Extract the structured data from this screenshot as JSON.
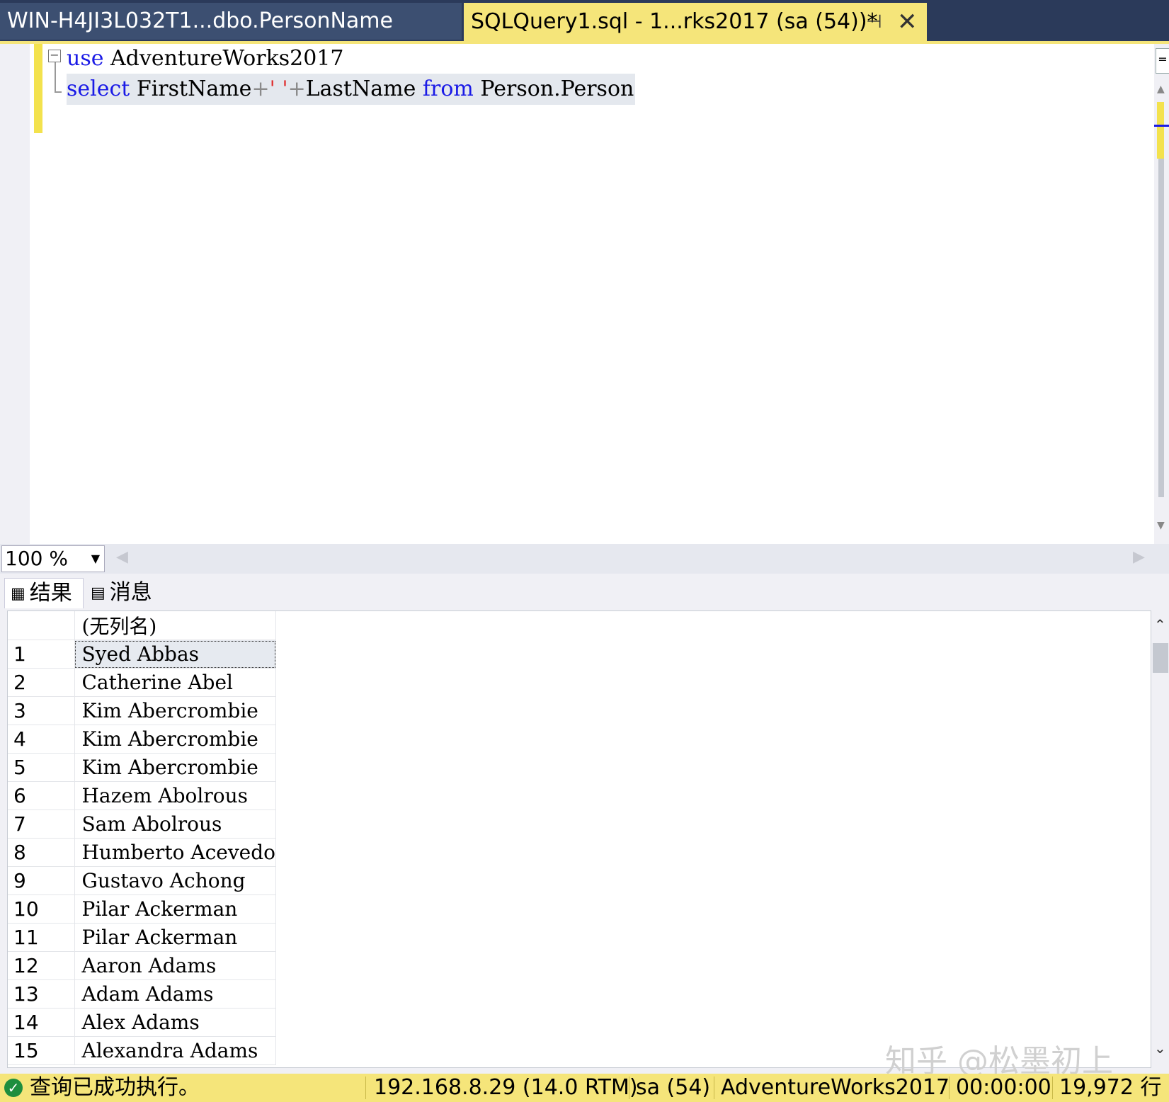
{
  "tabs": [
    {
      "label": "WIN-H4JI3L032T1...dbo.PersonName"
    },
    {
      "label": "SQLQuery1.sql - 1...rks2017 (sa (54))*"
    }
  ],
  "tab_icons": {
    "pin": "pin-icon",
    "close": "close-icon"
  },
  "editor": {
    "line1": {
      "keyword": "use",
      "text": " AdventureWorks2017"
    },
    "line2": {
      "kw_select": "select",
      "part1": " FirstName",
      "op1": "+",
      "str": "' '",
      "op2": "+",
      "part2": "LastName ",
      "kw_from": "from",
      "part3": " Person.Person"
    }
  },
  "zoom": {
    "value": "100 %"
  },
  "results_tabs": {
    "results": "结果",
    "messages": "消息"
  },
  "grid": {
    "column_header": "(无列名)",
    "rows": [
      {
        "n": "1",
        "v": "Syed Abbas"
      },
      {
        "n": "2",
        "v": "Catherine Abel"
      },
      {
        "n": "3",
        "v": "Kim Abercrombie"
      },
      {
        "n": "4",
        "v": "Kim Abercrombie"
      },
      {
        "n": "5",
        "v": "Kim Abercrombie"
      },
      {
        "n": "6",
        "v": "Hazem Abolrous"
      },
      {
        "n": "7",
        "v": "Sam Abolrous"
      },
      {
        "n": "8",
        "v": "Humberto Acevedo"
      },
      {
        "n": "9",
        "v": "Gustavo Achong"
      },
      {
        "n": "10",
        "v": "Pilar Ackerman"
      },
      {
        "n": "11",
        "v": "Pilar Ackerman"
      },
      {
        "n": "12",
        "v": "Aaron Adams"
      },
      {
        "n": "13",
        "v": "Adam Adams"
      },
      {
        "n": "14",
        "v": "Alex Adams"
      },
      {
        "n": "15",
        "v": "Alexandra Adams"
      }
    ]
  },
  "watermark": "知乎 @松墨初上",
  "status": {
    "message": "查询已成功执行。",
    "server": "192.168.8.29 (14.0 RTM)",
    "user": "sa (54)",
    "database": "AdventureWorks2017",
    "elapsed": "00:00:00",
    "rows": "19,972 行"
  },
  "colors": {
    "tab_active": "#f5e57a",
    "tab_inactive": "#3c4f71",
    "keyword": "#1a1ae6",
    "string": "#e03030",
    "status_bar": "#f5e57a"
  }
}
